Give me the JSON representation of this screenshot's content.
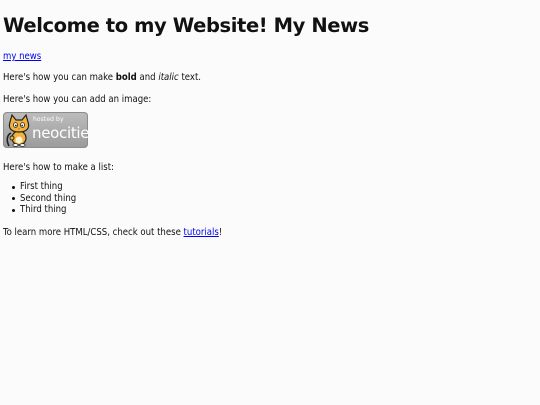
{
  "heading": "Welcome to my Website! My News",
  "news_link": "my news",
  "intro": {
    "prefix": "Here's how you can make ",
    "bold": "bold",
    "middle": " and ",
    "italic": "italic",
    "suffix": " text."
  },
  "image_intro": "Here's how you can add an image:",
  "badge": {
    "small_text": "hosted by",
    "big_text": "neocities",
    "mascot_icon": "neocities-cat-icon",
    "colors": {
      "background": "#a8a8a8",
      "text": "#ffffff",
      "mascot_fur": "#f2b33d"
    }
  },
  "list_intro": "Here's how to make a list:",
  "list_items": [
    "First thing",
    "Second thing",
    "Third thing"
  ],
  "learn": {
    "prefix": "To learn more HTML/CSS, check out these ",
    "link": "tutorials",
    "suffix": "!"
  },
  "colors": {
    "link": "#0000ee",
    "text": "#111111",
    "background": "#fbfbfb"
  }
}
